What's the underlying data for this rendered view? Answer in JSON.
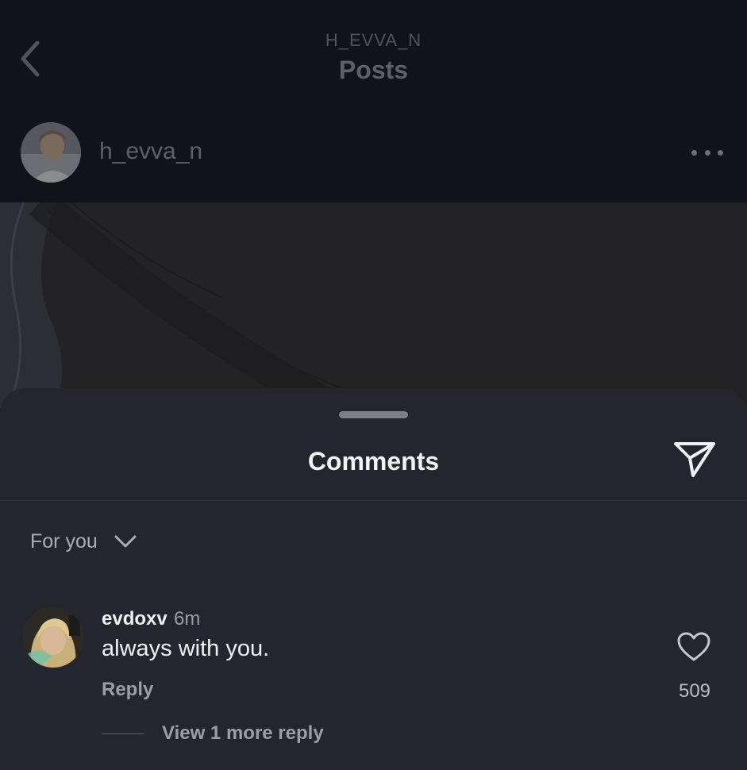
{
  "header": {
    "subtitle": "H_EVVA_N",
    "title": "Posts"
  },
  "author": {
    "username": "h_evva_n"
  },
  "sheet": {
    "title": "Comments",
    "sort_label": "For you"
  },
  "comments": [
    {
      "username": "evdoxv",
      "time": "6m",
      "text": "always with you.",
      "reply_label": "Reply",
      "like_count": "509",
      "more_replies_label": "View 1 more reply"
    }
  ],
  "icons": {
    "back": "chevron-left-icon",
    "more": "more-horizontal-icon",
    "share": "paper-plane-icon",
    "sort": "chevron-down-icon",
    "like": "heart-outline-icon"
  },
  "colors": {
    "background": "#121318",
    "sheet": "#24262d",
    "text_primary": "#f0f1f3",
    "text_secondary": "#9a9ea6"
  }
}
